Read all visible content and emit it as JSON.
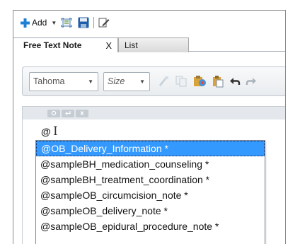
{
  "toolbar": {
    "add_label": "Add",
    "icons": [
      "plus-icon",
      "dropdown-caret-icon",
      "fit-page-icon",
      "save-disk-icon",
      "edit-note-icon"
    ]
  },
  "tabs": [
    {
      "label": "Free Text Note",
      "active": true,
      "close": "X"
    },
    {
      "label": "List",
      "active": false
    }
  ],
  "format_bar": {
    "font_value": "Tahoma",
    "size_placeholder": "Size",
    "icons": [
      "format-painter-icon",
      "copy-icon",
      "paste-special-icon",
      "paste-icon",
      "undo-icon",
      "redo-icon"
    ]
  },
  "editor": {
    "typed_text": "@",
    "mini_toolbar_icons": [
      "refresh-icon",
      "enter-icon",
      "close-icon"
    ]
  },
  "autocomplete": {
    "items": [
      "@OB_Delivery_Information *",
      "@sampleBH_medication_counseling *",
      "@sampleBH_treatment_coordination *",
      "@sampleOB_circumcision_note *",
      "@sampleOB_delivery_note *",
      "@sampleOB_epidural_procedure_note *"
    ],
    "selected_index": 0
  },
  "colors": {
    "selection": "#3399ff",
    "add_plus": "#1e7fd6",
    "save_icon": "#1f5fa8"
  }
}
